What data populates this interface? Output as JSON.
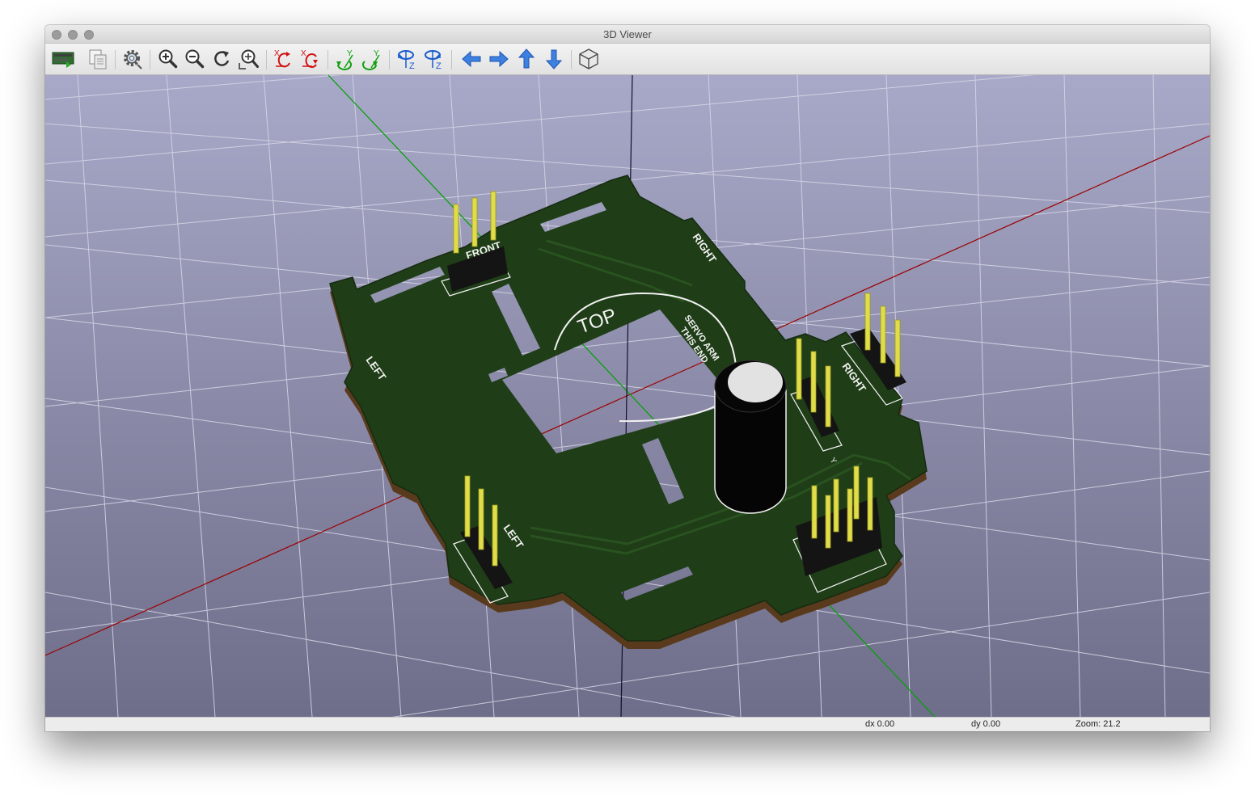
{
  "window": {
    "title": "3D Viewer"
  },
  "toolbar": {
    "buttons": [
      {
        "name": "reload-board-button",
        "icon": "reload-board-icon"
      },
      {
        "name": "copy-image-button",
        "icon": "copy-icon"
      },
      {
        "name": "settings-button",
        "icon": "gear-icon"
      },
      {
        "name": "zoom-in-button",
        "icon": "zoom-in-icon"
      },
      {
        "name": "zoom-out-button",
        "icon": "zoom-out-icon"
      },
      {
        "name": "redraw-button",
        "icon": "redraw-icon"
      },
      {
        "name": "zoom-fit-button",
        "icon": "zoom-fit-icon"
      },
      {
        "name": "rotate-x-cw-button",
        "icon": "rotate-x-cw-icon",
        "glyph": "X"
      },
      {
        "name": "rotate-x-ccw-button",
        "icon": "rotate-x-ccw-icon",
        "glyph": "X"
      },
      {
        "name": "rotate-y-cw-button",
        "icon": "rotate-y-cw-icon",
        "glyph": "Y"
      },
      {
        "name": "rotate-y-ccw-button",
        "icon": "rotate-y-ccw-icon",
        "glyph": "Y"
      },
      {
        "name": "rotate-z-cw-button",
        "icon": "rotate-z-cw-icon",
        "glyph": "Z"
      },
      {
        "name": "rotate-z-ccw-button",
        "icon": "rotate-z-ccw-icon",
        "glyph": "Z"
      },
      {
        "name": "pan-left-button",
        "icon": "arrow-left-icon"
      },
      {
        "name": "pan-right-button",
        "icon": "arrow-right-icon"
      },
      {
        "name": "pan-up-button",
        "icon": "arrow-up-icon"
      },
      {
        "name": "pan-down-button",
        "icon": "arrow-down-icon"
      },
      {
        "name": "orthographic-toggle-button",
        "icon": "cube-icon"
      }
    ]
  },
  "scene": {
    "silkscreen": {
      "front": "FRONT",
      "right_top": "RIGHT",
      "top": "TOP",
      "servo_line1": "SERVO ARM",
      "servo_line2": "THIS END",
      "left_mid": "LEFT",
      "right_mid": "RIGHT",
      "left_bottom": "LEFT",
      "y_marker": "Y"
    },
    "colors": {
      "background_top": "#a8a8c8",
      "background_bottom": "#6e6e8a",
      "board": "#1f3d17",
      "board_edge": "#5a3a1c",
      "silkscreen": "#f2f2f2",
      "x_axis": "#9b0000",
      "y_axis": "#00a000",
      "z_axis": "#101030",
      "pin": "#e0dc4a",
      "header_body": "#141414",
      "capacitor": "#050505"
    }
  },
  "status": {
    "dx": "dx 0.00",
    "dy": "dy 0.00",
    "zoom": "Zoom: 21.2"
  }
}
